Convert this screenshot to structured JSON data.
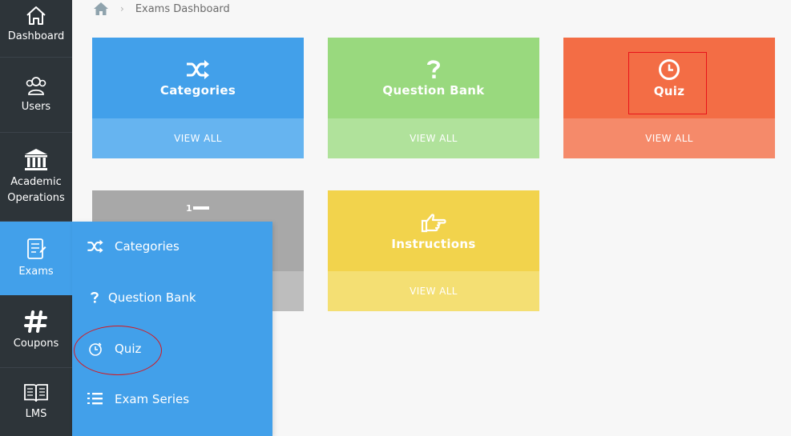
{
  "breadcrumb": {
    "home_icon": "home-icon",
    "current": "Exams Dashboard"
  },
  "sidebar": {
    "items": [
      {
        "label": "Dashboard",
        "icon": "home-icon"
      },
      {
        "label": "Users",
        "icon": "users-icon"
      },
      {
        "label": "Academic Operations",
        "icon": "bank-icon"
      },
      {
        "label": "Exams",
        "icon": "clipboard-icon",
        "active": true
      },
      {
        "label": "Coupons",
        "icon": "hash-icon"
      },
      {
        "label": "LMS",
        "icon": "book-icon"
      }
    ]
  },
  "cards": [
    {
      "title": "Categories",
      "action": "VIEW ALL",
      "icon": "shuffle-icon",
      "color": "#42a0ea"
    },
    {
      "title": "Question Bank",
      "action": "VIEW ALL",
      "icon": "question-icon",
      "color": "#99d97e"
    },
    {
      "title": "Quiz",
      "action": "VIEW ALL",
      "icon": "clock-icon",
      "color": "#f36d45"
    },
    {
      "title": "",
      "action": "",
      "icon": "numbered-list-icon",
      "color": "#a8a8a8"
    },
    {
      "title": "Instructions",
      "action": "VIEW ALL",
      "icon": "pointing-hand-icon",
      "color": "#f2d34c"
    }
  ],
  "submenu": {
    "items": [
      {
        "label": "Categories",
        "icon": "shuffle-icon"
      },
      {
        "label": "Question Bank",
        "icon": "question-icon"
      },
      {
        "label": "Quiz",
        "icon": "timer-icon"
      },
      {
        "label": "Exam Series",
        "icon": "numbered-list-icon"
      }
    ]
  },
  "colors": {
    "sidebar_bg": "#2d3439",
    "active_blue": "#42a0ea",
    "highlight_red": "#e8131b"
  }
}
